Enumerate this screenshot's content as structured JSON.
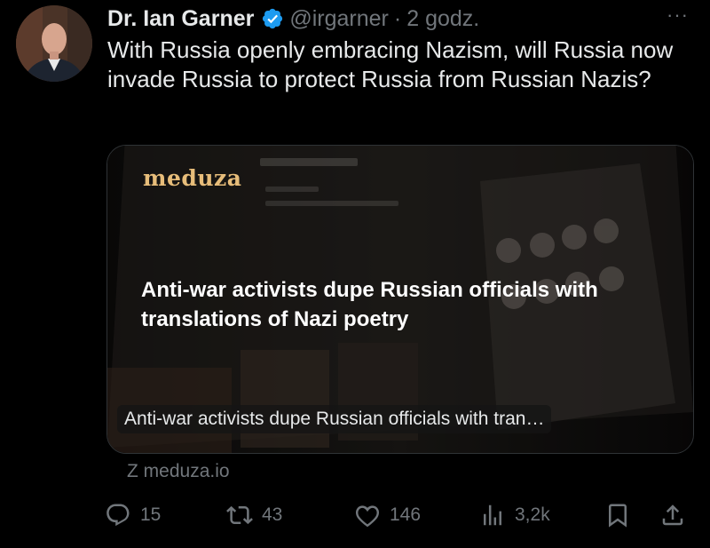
{
  "author": {
    "name": "Dr. Ian Garner",
    "handle": "@irgarner",
    "separator": "·",
    "time": "2 godz.",
    "verified": true
  },
  "tweet": {
    "text": "With Russia openly embracing Nazism, will Russia now invade Russia to protect Russia from Russian Nazis?"
  },
  "card": {
    "logo": "meduza",
    "headline": "Anti-war activists dupe Russian officials with translations of Nazi poetry",
    "caption": "Anti-war activists dupe Russian officials with tran…",
    "source": "Z meduza.io"
  },
  "actions": {
    "replies": "15",
    "retweets": "43",
    "likes": "146",
    "views": "3,2k"
  },
  "more_label": "···",
  "colors": {
    "background": "#000000",
    "text": "#e7e9ea",
    "muted": "#71767b",
    "verified": "#1d9bf0",
    "logo": "#e7bd7a"
  }
}
